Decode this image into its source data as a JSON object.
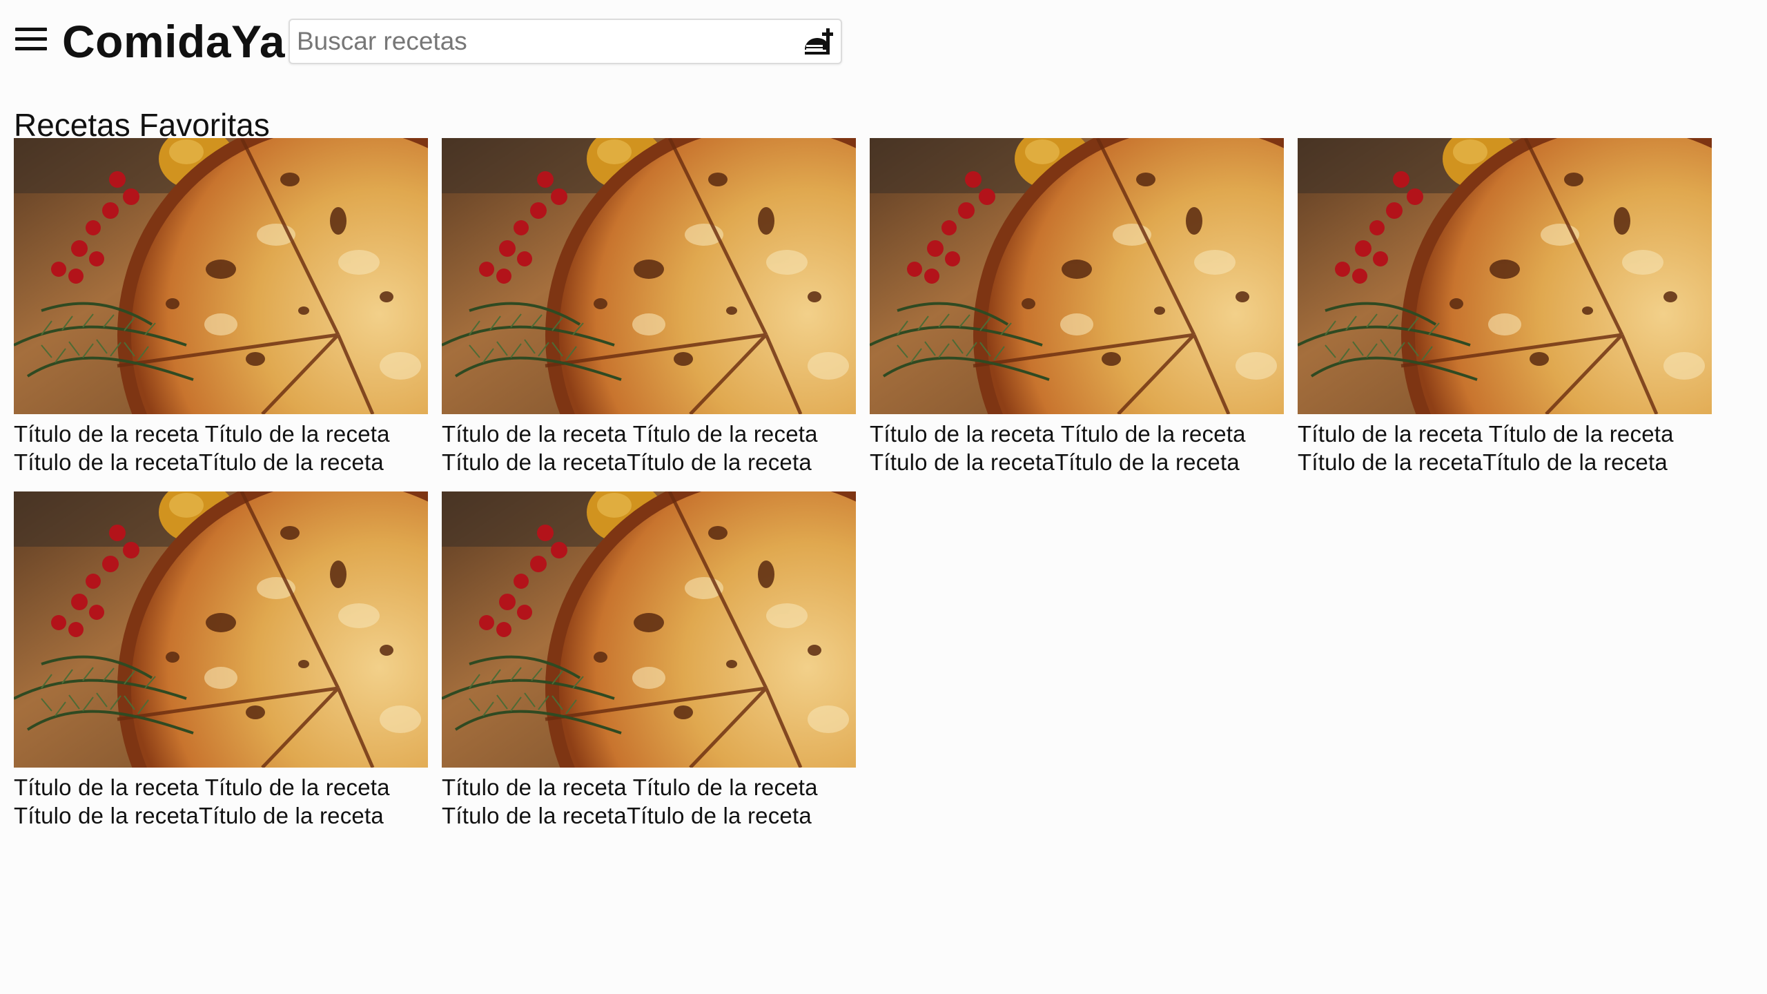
{
  "header": {
    "app_title": "ComidaYa",
    "menu_icon": "menu-icon",
    "search": {
      "placeholder": "Buscar recetas",
      "value": "",
      "icon": "food-serving-icon"
    }
  },
  "main": {
    "section_title": "Recetas Favoritas",
    "recipes": [
      {
        "title": "Título de la receta Título de la receta\nTítulo de la recetaTítulo de la receta",
        "image": "pizza-photo"
      },
      {
        "title": "Título de la receta Título de la receta\nTítulo de la recetaTítulo de la receta",
        "image": "pizza-photo"
      },
      {
        "title": "Título de la receta Título de la receta\nTítulo de la recetaTítulo de la receta",
        "image": "pizza-photo"
      },
      {
        "title": "Título de la receta Título de la receta\nTítulo de la recetaTítulo de la receta",
        "image": "pizza-photo"
      },
      {
        "title": "Título de la receta Título de la receta\nTítulo de la recetaTítulo de la receta",
        "image": "pizza-photo"
      },
      {
        "title": "Título de la receta Título de la receta\nTítulo de la recetaTítulo de la receta",
        "image": "pizza-photo"
      }
    ]
  }
}
